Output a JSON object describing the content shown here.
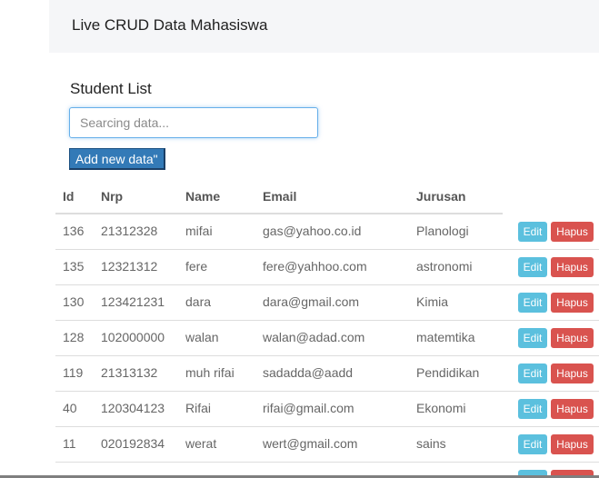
{
  "header": {
    "title": "Live CRUD Data Mahasiswa"
  },
  "main": {
    "section_title": "Student List",
    "search": {
      "placeholder": "Searcing data...",
      "value": ""
    },
    "add_button_label": "Add new data\"",
    "table": {
      "columns": [
        "Id",
        "Nrp",
        "Name",
        "Email",
        "Jurusan"
      ],
      "rows": [
        {
          "id": "136",
          "nrp": "21312328",
          "name": "mifai",
          "email": "gas@yahoo.co.id",
          "jurusan": "Planologi"
        },
        {
          "id": "135",
          "nrp": "12321312",
          "name": "fere",
          "email": "fere@yahhoo.com",
          "jurusan": "astronomi"
        },
        {
          "id": "130",
          "nrp": "123421231",
          "name": "dara",
          "email": "dara@gmail.com",
          "jurusan": "Kimia"
        },
        {
          "id": "128",
          "nrp": "102000000",
          "name": "walan",
          "email": "walan@adad.com",
          "jurusan": "matemtika"
        },
        {
          "id": "119",
          "nrp": "21313132",
          "name": "muh rifai",
          "email": "sadadda@aadd",
          "jurusan": "Pendidikan"
        },
        {
          "id": "40",
          "nrp": "120304123",
          "name": "Rifai",
          "email": "rifai@gmail.com",
          "jurusan": "Ekonomi"
        },
        {
          "id": "11",
          "nrp": "020192834",
          "name": "werat",
          "email": "wert@gmail.com",
          "jurusan": "sains"
        },
        {
          "id": "",
          "nrp": "",
          "name": "",
          "email": "",
          "jurusan": ""
        }
      ],
      "edit_label": "Edit",
      "delete_label": "Hapus"
    }
  },
  "colors": {
    "primary": "#337ab7",
    "info": "#5bc0de",
    "danger": "#d9534f",
    "topbar_bg": "#f5f6f8"
  }
}
